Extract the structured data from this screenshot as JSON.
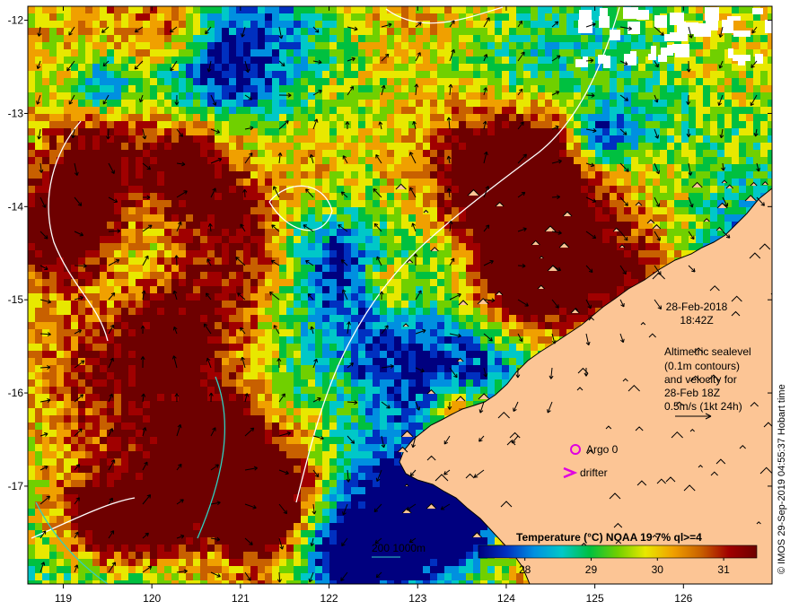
{
  "map": {
    "lon_ticks": [
      "119",
      "120",
      "121",
      "122",
      "123",
      "124",
      "125",
      "126"
    ],
    "lat_ticks": [
      "-12",
      "-13",
      "-14",
      "-15",
      "-16",
      "-17"
    ],
    "lon_range": [
      118.6,
      127.0
    ],
    "lat_range": [
      -11.85,
      -18.05
    ],
    "date": "28-Feb-2018",
    "time": "18:42Z",
    "info_lines": [
      "Altimetric sealevel",
      "(0.1m contours)",
      "and velocity for",
      "28-Feb 18Z",
      "0.5m/s (1kt 24h)"
    ],
    "argo_label": "Argo 0",
    "drifter_label": "drifter",
    "scale_label": "200  1000m",
    "colorbar": {
      "title": "Temperature (°C) NOAA 19 7% ql>=4",
      "ticks": [
        "28",
        "29",
        "30",
        "31"
      ],
      "tick_values": [
        28,
        29,
        30,
        31
      ],
      "range": [
        27.3,
        31.5
      ],
      "colors": [
        "#00007f",
        "#0030c0",
        "#0090e0",
        "#00c8c8",
        "#00c040",
        "#70d000",
        "#e8e800",
        "#f0a000",
        "#c86000",
        "#a00000",
        "#6e0000"
      ]
    },
    "credit": "© IMOS 29-Sep-2019 04:55:37 Hobart time",
    "colors": {
      "land": "#fcc595",
      "argo": "#e000e0",
      "contour": "#ffffff",
      "shelf": "#30d0c0"
    }
  }
}
